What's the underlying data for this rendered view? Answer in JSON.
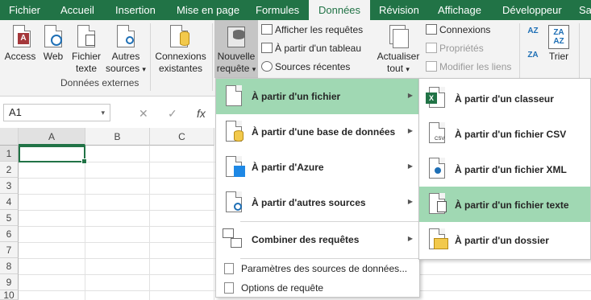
{
  "ribbon_tabs": [
    "Fichier",
    "Accueil",
    "Insertion",
    "Mise en page",
    "Formules",
    "Données",
    "Révision",
    "Affichage",
    "Développeur",
    "Sa"
  ],
  "active_tab": "Données",
  "colors": {
    "excel_green": "#217346",
    "menu_highlight": "#a0d8b3",
    "ribbon_bg": "#f3f3f3"
  },
  "ribbon": {
    "access": "Access",
    "web": "Web",
    "fichier_texte_1": "Fichier",
    "fichier_texte_2": "texte",
    "autres_sources_1": "Autres",
    "autres_sources_2": "sources",
    "connexions_existantes_1": "Connexions",
    "connexions_existantes_2": "existantes",
    "group_donnees_externes": "Données externes",
    "nouvelle_requete_1": "Nouvelle",
    "nouvelle_requete_2": "requête",
    "afficher_requetes": "Afficher les requêtes",
    "a_partir_tableau": "À partir d'un tableau",
    "sources_recentes": "Sources récentes",
    "actualiser_1": "Actualiser",
    "actualiser_2": "tout",
    "connexions": "Connexions",
    "proprietes": "Propriétés",
    "modifier_liens": "Modifier les liens",
    "trier": "Trier",
    "az": "AZ",
    "za": "ZA",
    "dropdown_caret": "▾"
  },
  "formula_bar": {
    "name_box": "A1",
    "cancel": "✕",
    "enter": "✓",
    "fx": "fx"
  },
  "grid": {
    "columns": [
      "A",
      "B",
      "C"
    ],
    "rows": [
      "1",
      "2",
      "3",
      "4",
      "5",
      "6",
      "7",
      "8",
      "9",
      "10"
    ]
  },
  "menu_main": {
    "items": [
      "À partir d'un fichier",
      "À partir d'une base de données",
      "À partir d'Azure",
      "À partir d'autres sources",
      "Combiner des requêtes"
    ],
    "small_items": [
      "Paramètres des sources de données...",
      "Options de requête"
    ]
  },
  "menu_sub": {
    "items": [
      "À partir d'un classeur",
      "À partir d'un fichier CSV",
      "À partir d'un fichier XML",
      "À partir d'un fichier texte",
      "À partir d'un dossier"
    ],
    "csv_tag": "CSV"
  }
}
